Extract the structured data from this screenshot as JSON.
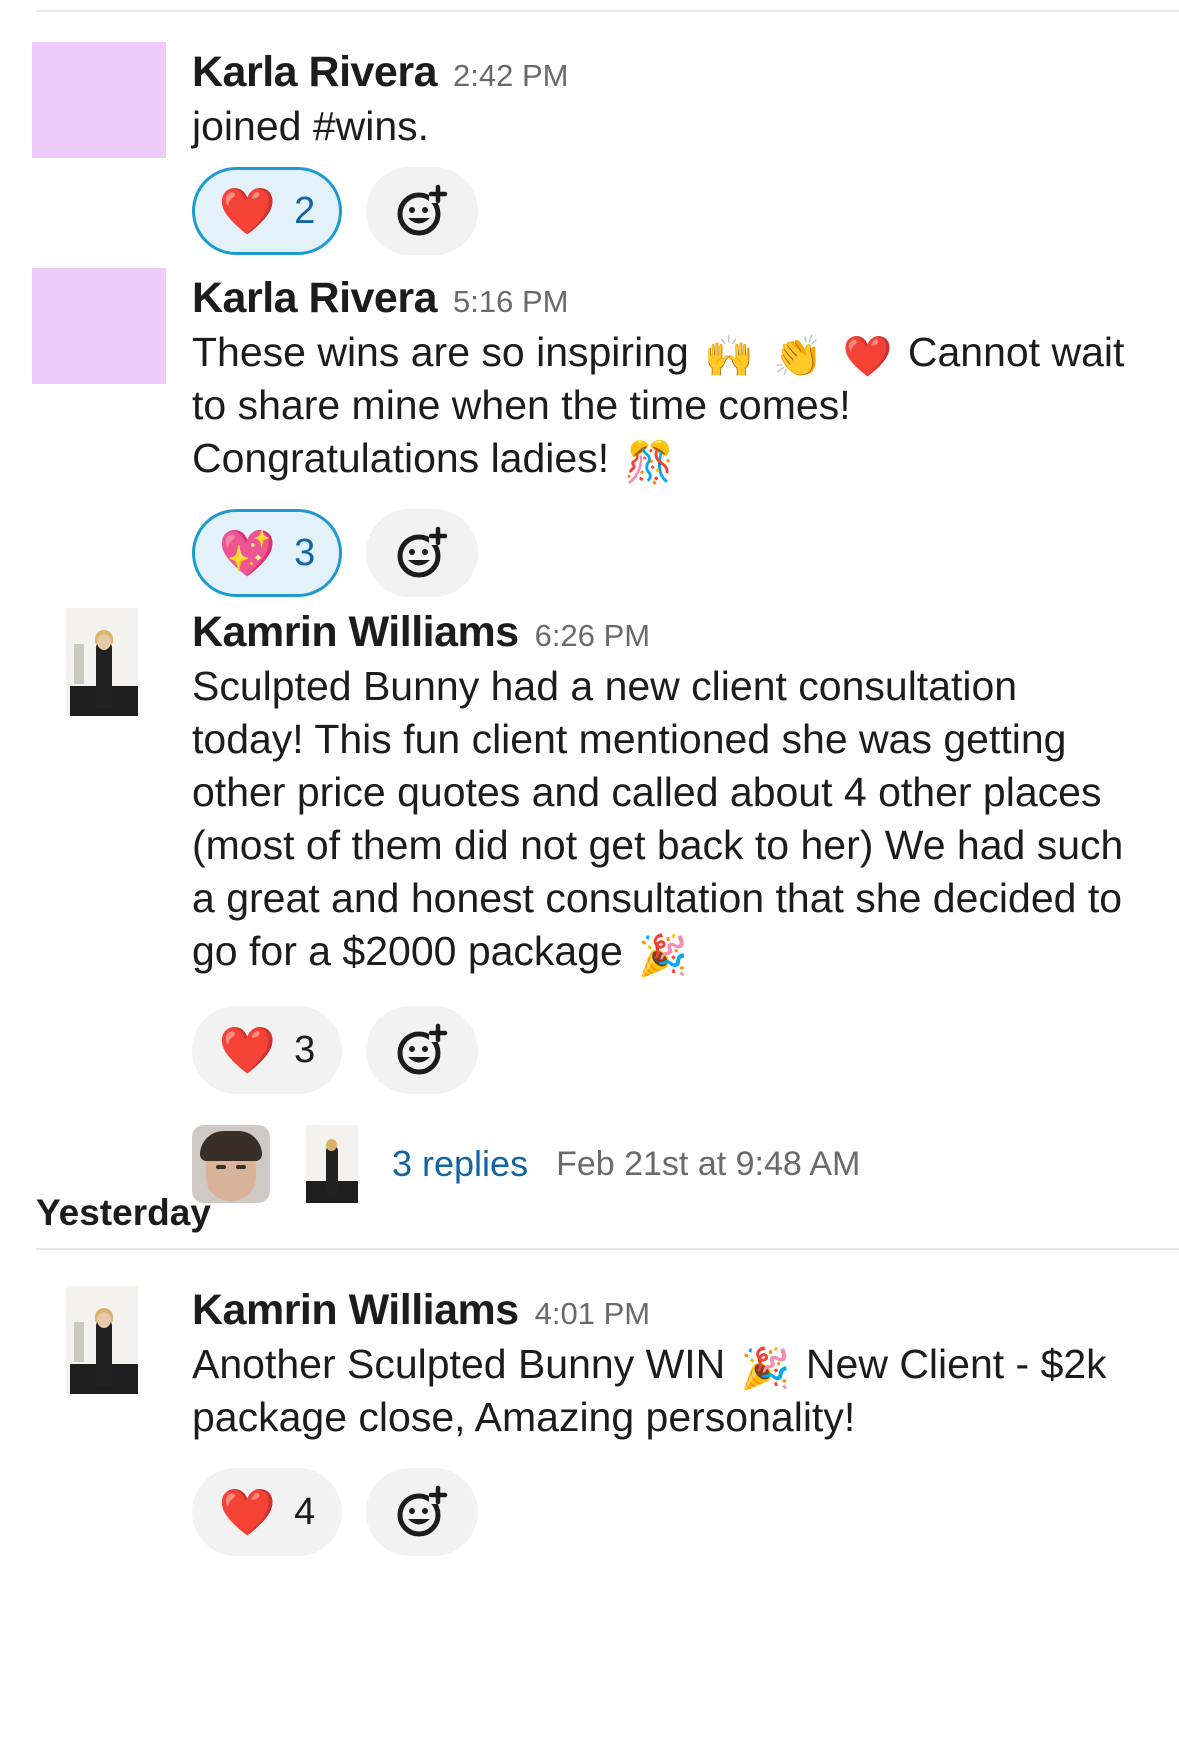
{
  "messages": [
    {
      "name": "Karla Rivera",
      "time": "2:42 PM",
      "text": "joined #wins.",
      "reactions": [
        {
          "emoji": "❤️",
          "count": "2",
          "active": true
        }
      ]
    },
    {
      "name": "Karla Rivera",
      "time": "5:16 PM",
      "text_parts": [
        "These wins are so inspiring",
        "🙌",
        "👏",
        "❤️",
        "Cannot wait to share mine when the time comes! Congratulations ladies!",
        "🎊"
      ],
      "reactions": [
        {
          "emoji": "💖",
          "count": "3",
          "active": true
        }
      ]
    },
    {
      "name": "Kamrin Williams",
      "time": "6:26 PM",
      "text_parts": [
        "Sculpted Bunny had a new client consultation today! This fun client mentioned she was getting other price quotes and called about 4 other places (most of them did not get back to her) We had such a great and honest consultation that she decided to go for a $2000 package",
        "🎉"
      ],
      "reactions": [
        {
          "emoji": "❤️",
          "count": "3",
          "active": false
        }
      ],
      "thread": {
        "replies": "3 replies",
        "last_reply": "Feb 21st at 9:48 AM"
      }
    },
    {
      "name": "Kamrin Williams",
      "time": "4:01 PM",
      "text_parts": [
        "Another Sculpted Bunny WIN",
        "🎉",
        "New Client - $2k package close, Amazing personality!"
      ],
      "reactions": [
        {
          "emoji": "❤️",
          "count": "4",
          "active": false
        }
      ]
    }
  ],
  "day_divider": "Yesterday",
  "icons": {
    "add_reaction": "add-reaction-icon"
  },
  "colors": {
    "accent_blue": "#1d9bd1",
    "link": "#1264a3",
    "avatar_placeholder": "#efcbfa"
  }
}
